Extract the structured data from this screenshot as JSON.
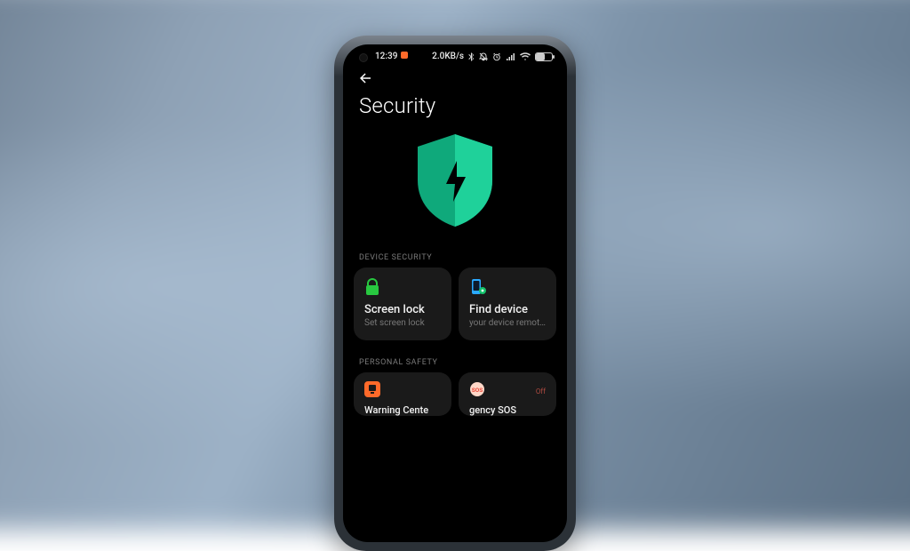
{
  "statusbar": {
    "time": "12:39",
    "net_speed": "2.0KB/s"
  },
  "header": {
    "title": "Security"
  },
  "sections": {
    "device_security_label": "DEVICE SECURITY",
    "personal_safety_label": "PERSONAL SAFETY"
  },
  "tiles": {
    "screen_lock": {
      "title": "Screen lock",
      "subtitle": "Set screen lock"
    },
    "find_device": {
      "title": "Find device",
      "subtitle": "your device remot…"
    },
    "warning_centre": {
      "title": "Warning Cente"
    },
    "emergency_sos": {
      "title": "gency SOS",
      "badge": "Off"
    }
  },
  "colors": {
    "shield_front": "#1fd19a",
    "shield_back": "#0fa97b",
    "lock_icon": "#28c840",
    "find_icon": "#2aa9ff",
    "warning_bg": "#ff6a2a",
    "sos_fg": "#e94b3c"
  }
}
